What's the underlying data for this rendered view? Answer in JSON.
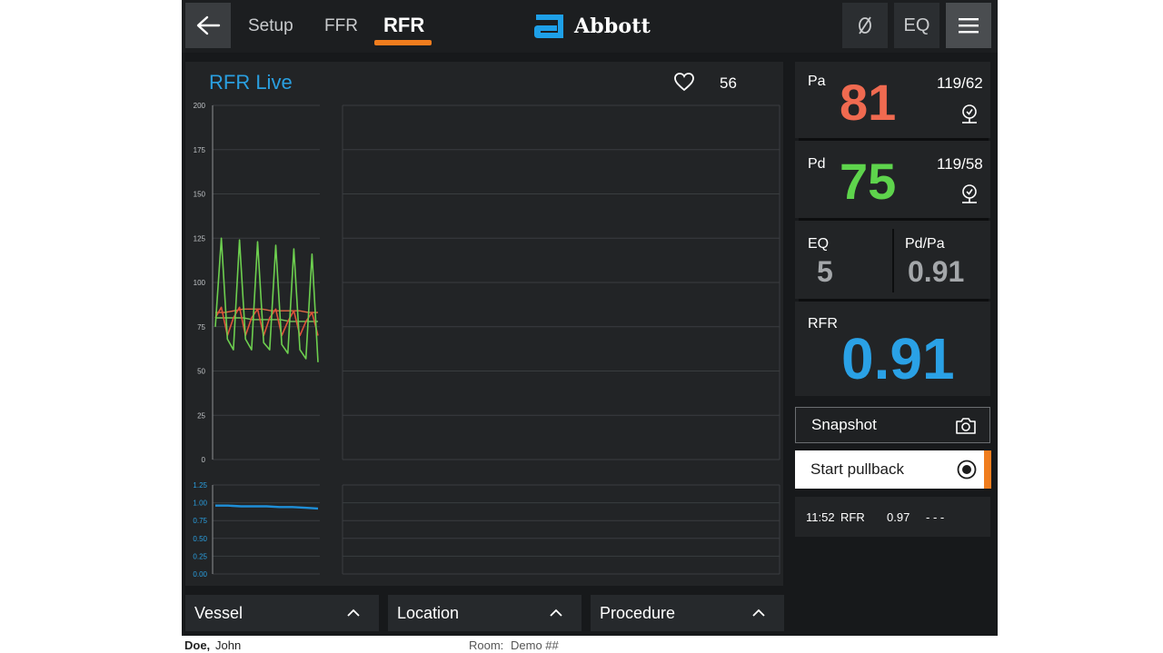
{
  "header": {
    "tabs": [
      {
        "label": "Setup",
        "active": false
      },
      {
        "label": "FFR",
        "active": false
      },
      {
        "label": "RFR",
        "active": true
      }
    ],
    "brand": "Abbott",
    "eq_button_label": "EQ",
    "accent_color": "#f07d1e"
  },
  "chart": {
    "title": "RFR Live",
    "heart_rate": "56",
    "pressure_axis_ticks": [
      "200",
      "175",
      "150",
      "125",
      "100",
      "75",
      "50",
      "25",
      "0"
    ],
    "ratio_axis_ticks": [
      "1.25",
      "1.00",
      "0.75",
      "0.50",
      "0.25",
      "0.00"
    ]
  },
  "chart_data": [
    {
      "type": "line",
      "ylim": [
        0,
        200
      ],
      "yticks": [
        200,
        175,
        150,
        125,
        100,
        75,
        50,
        25,
        0
      ],
      "series": [
        {
          "color": "#6dcf4f",
          "values": [
            75,
            125,
            68,
            62,
            124,
            68,
            62,
            123,
            66,
            62,
            121,
            65,
            60,
            119,
            62,
            57,
            116,
            55
          ]
        },
        {
          "color": "#e0523a",
          "values": [
            80,
            86,
            70,
            80,
            86,
            70,
            80,
            85,
            70,
            80,
            85,
            70,
            78,
            84,
            70,
            78,
            83,
            70
          ]
        },
        {
          "color": "#e06a44",
          "values": [
            83,
            83,
            84,
            85,
            85,
            85,
            84,
            84,
            84,
            84,
            83,
            83
          ]
        },
        {
          "color": "#7ac85a",
          "values": [
            80,
            80,
            80,
            80,
            79,
            79,
            79,
            79,
            78,
            78,
            78,
            78
          ]
        }
      ]
    },
    {
      "type": "line",
      "ylim": [
        0,
        1.25
      ],
      "yticks": [
        1.25,
        1.0,
        0.75,
        0.5,
        0.25,
        0.0
      ],
      "series": [
        {
          "color": "#1e8fd8",
          "values": [
            0.96,
            0.96,
            0.95,
            0.95,
            0.95,
            0.94,
            0.94,
            0.93,
            0.92
          ]
        }
      ]
    }
  ],
  "readouts": {
    "pa": {
      "label": "Pa",
      "value": "81",
      "sys_dia": "119/62",
      "color": "#f06a50"
    },
    "pd": {
      "label": "Pd",
      "value": "75",
      "sys_dia": "119/58",
      "color": "#5ed44c"
    },
    "eq": {
      "label": "EQ",
      "value": "5"
    },
    "pdpa": {
      "label": "Pd/Pa",
      "value": "0.91"
    },
    "rfr": {
      "label": "RFR",
      "value": "0.91",
      "color": "#2aa1e6"
    }
  },
  "actions": {
    "snapshot_label": "Snapshot",
    "pullback_label": "Start pullback"
  },
  "history": [
    {
      "time": "11:52",
      "type": "RFR",
      "value": "0.97",
      "extra": "- - -"
    }
  ],
  "dropdowns": [
    {
      "label": "Vessel"
    },
    {
      "label": "Location"
    },
    {
      "label": "Procedure"
    }
  ],
  "status": {
    "patient_last": "Doe,",
    "patient_first": "John",
    "room_label": "Room:",
    "room_value": "Demo ##"
  }
}
